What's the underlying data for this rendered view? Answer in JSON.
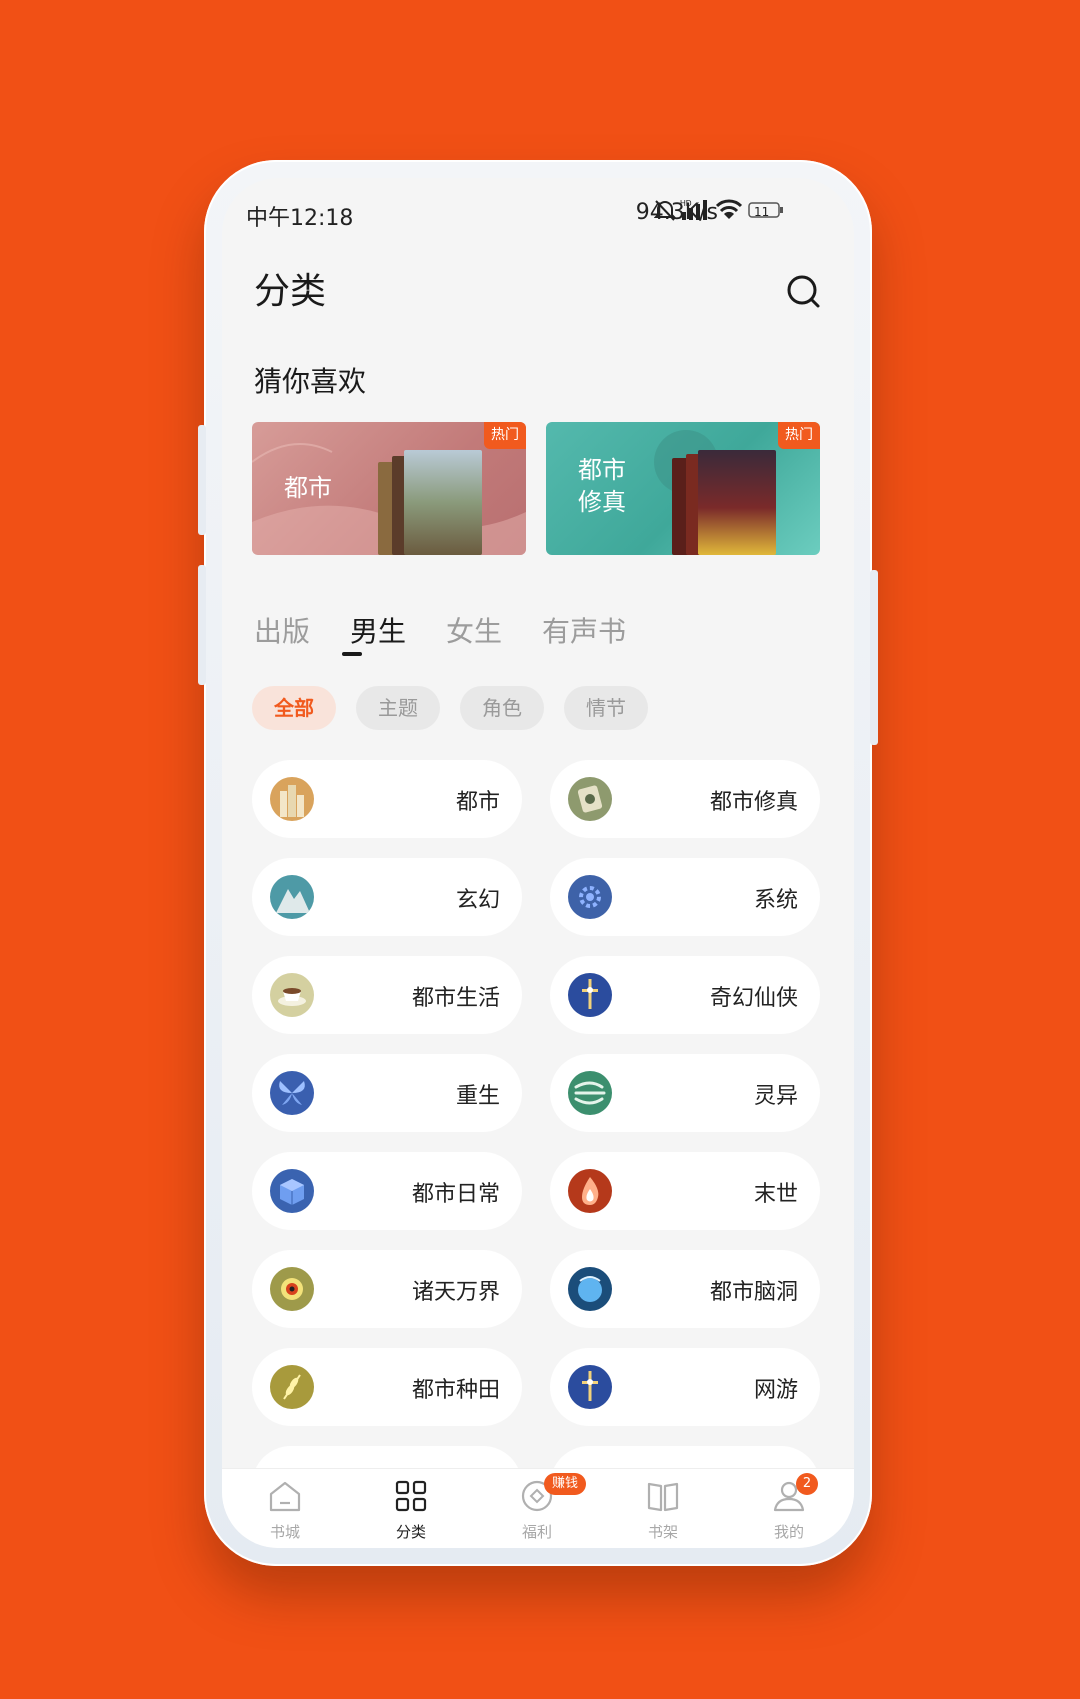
{
  "status_bar": {
    "time": "中午12:18",
    "network_speed": "94.3K/s",
    "battery": "11"
  },
  "header": {
    "title": "分类",
    "search_icon": "search-icon"
  },
  "recommend": {
    "title": "猜你喜欢",
    "banners": [
      {
        "label": "都市",
        "badge": "热门",
        "color": "#C9807F"
      },
      {
        "label_line1": "都市",
        "label_line2": "修真",
        "badge": "热门",
        "color": "#4FB5A5"
      }
    ]
  },
  "tabs": [
    {
      "label": "出版",
      "active": false
    },
    {
      "label": "男生",
      "active": true
    },
    {
      "label": "女生",
      "active": false
    },
    {
      "label": "有声书",
      "active": false
    }
  ],
  "filters": [
    {
      "label": "全部",
      "active": true
    },
    {
      "label": "主题",
      "active": false
    },
    {
      "label": "角色",
      "active": false
    },
    {
      "label": "情节",
      "active": false
    }
  ],
  "categories": [
    {
      "label": "都市",
      "icon": "city-icon",
      "color": "#D9A35C"
    },
    {
      "label": "都市修真",
      "icon": "taiji-icon",
      "color": "#8E9A6E"
    },
    {
      "label": "玄幻",
      "icon": "mountain-icon",
      "color": "#4E9AA6"
    },
    {
      "label": "系统",
      "icon": "gear-icon",
      "color": "#3E62A8"
    },
    {
      "label": "都市生活",
      "icon": "coffee-icon",
      "color": "#D4D0A0"
    },
    {
      "label": "奇幻仙侠",
      "icon": "sword-icon",
      "color": "#2B4C9E"
    },
    {
      "label": "重生",
      "icon": "butterfly-icon",
      "color": "#3A5FAF"
    },
    {
      "label": "灵异",
      "icon": "wind-icon",
      "color": "#3C8F6E"
    },
    {
      "label": "都市日常",
      "icon": "cube-icon",
      "color": "#3A63B0"
    },
    {
      "label": "末世",
      "icon": "fire-icon",
      "color": "#B5391B"
    },
    {
      "label": "诸天万界",
      "icon": "eye-icon",
      "color": "#9E9A4A"
    },
    {
      "label": "都市脑洞",
      "icon": "globe-icon",
      "color": "#1B4D7A"
    },
    {
      "label": "都市种田",
      "icon": "wheat-icon",
      "color": "#A89A3C"
    },
    {
      "label": "网游",
      "icon": "sword-icon",
      "color": "#2B4C9E"
    }
  ],
  "tabbar": {
    "items": [
      {
        "label": "书城",
        "icon": "home-icon",
        "active": false
      },
      {
        "label": "分类",
        "icon": "grid-icon",
        "active": true
      },
      {
        "label": "福利",
        "icon": "coin-icon",
        "active": false,
        "badge": "赚钱"
      },
      {
        "label": "书架",
        "icon": "book-icon",
        "active": false
      },
      {
        "label": "我的",
        "icon": "user-icon",
        "active": false,
        "badge": "2"
      }
    ]
  },
  "colors": {
    "background": "#F15015",
    "accent": "#F15A1E"
  }
}
